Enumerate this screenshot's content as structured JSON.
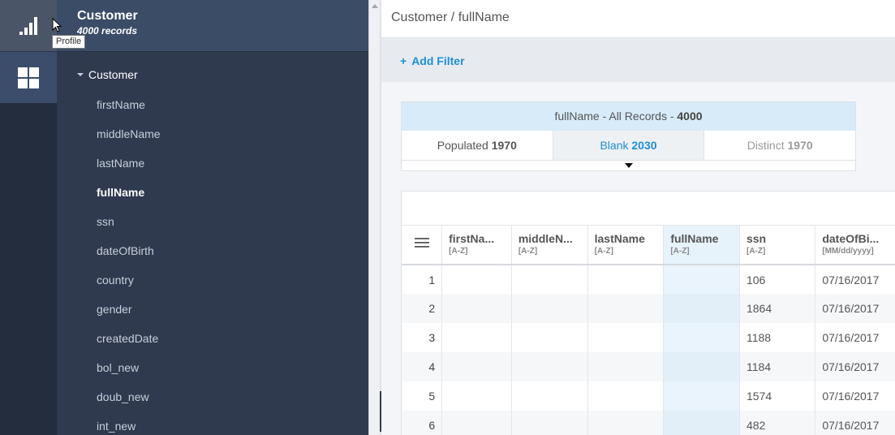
{
  "rail": {
    "items": [
      {
        "icon": "bar-chart-icon",
        "tooltip": "Profile"
      },
      {
        "icon": "dashboard-grid-icon"
      }
    ]
  },
  "tree": {
    "title": "Customer",
    "subtitle": "4000 records",
    "root": "Customer",
    "fields": [
      "firstName",
      "middleName",
      "lastName",
      "fullName",
      "ssn",
      "dateOfBirth",
      "country",
      "gender",
      "createdDate",
      "bol_new",
      "doub_new",
      "int_new"
    ],
    "active_field": "fullName"
  },
  "header": {
    "breadcrumb": "Customer / fullName"
  },
  "filter": {
    "plus": "+",
    "add_label": "Add Filter"
  },
  "profile": {
    "title_prefix": "fullName - All Records - ",
    "title_count": "4000",
    "stats": [
      {
        "label": "Populated",
        "value": "1970"
      },
      {
        "label": "Blank",
        "value": "2030"
      },
      {
        "label": "Distinct",
        "value": "1970"
      }
    ],
    "active_stat": "Blank"
  },
  "grid": {
    "columns": [
      {
        "name": "firstNa...",
        "type": "[A-Z]"
      },
      {
        "name": "middleN...",
        "type": "[A-Z]"
      },
      {
        "name": "lastName",
        "type": "[A-Z]"
      },
      {
        "name": "fullName",
        "type": "[A-Z]"
      },
      {
        "name": "ssn",
        "type": "[A-Z]"
      },
      {
        "name": "dateOfBi...",
        "type": "[MM/dd/yyyy]"
      }
    ],
    "selected_column": "fullName",
    "rows": [
      {
        "n": "1",
        "cells": [
          "",
          "",
          "",
          "",
          "106",
          "07/16/2017"
        ]
      },
      {
        "n": "2",
        "cells": [
          "",
          "",
          "",
          "",
          "1864",
          "07/16/2017"
        ]
      },
      {
        "n": "3",
        "cells": [
          "",
          "",
          "",
          "",
          "1188",
          "07/16/2017"
        ]
      },
      {
        "n": "4",
        "cells": [
          "",
          "",
          "",
          "",
          "1184",
          "07/16/2017"
        ]
      },
      {
        "n": "5",
        "cells": [
          "",
          "",
          "",
          "",
          "1574",
          "07/16/2017"
        ]
      },
      {
        "n": "6",
        "cells": [
          "",
          "",
          "",
          "",
          "482",
          "07/16/2017"
        ]
      }
    ]
  },
  "colors": {
    "accent": "#1c8fd6",
    "sidebar": "#2f3a4f",
    "rail": "#242d3d",
    "selected_column": "#e6f3fb"
  }
}
